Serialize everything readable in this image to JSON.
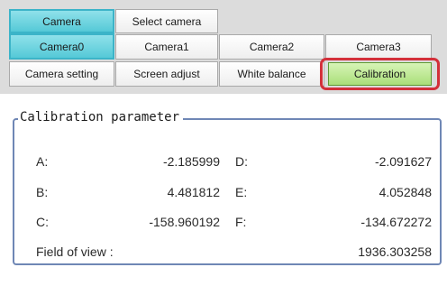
{
  "tabs": {
    "row1": [
      "Camera",
      "Select camera"
    ],
    "row2": [
      "Camera0",
      "Camera1",
      "Camera2",
      "Camera3"
    ],
    "row3": [
      "Camera setting",
      "Screen adjust",
      "White balance",
      "Calibration"
    ]
  },
  "calibration": {
    "title": "Calibration parameter",
    "rows": [
      {
        "l1": "A:",
        "v1": "-2.185999",
        "l2": "D:",
        "v2": "-2.091627"
      },
      {
        "l1": "B:",
        "v1": "4.481812",
        "l2": "E:",
        "v2": "4.052848"
      },
      {
        "l1": "C:",
        "v1": "-158.960192",
        "l2": "F:",
        "v2": "-134.672272"
      }
    ],
    "fov_label": "Field of view :",
    "fov_value": "1936.303258"
  },
  "colors": {
    "selected_tab": "#55c9d7",
    "highlight_outline": "#d3303a",
    "calibration_tab": "#aadf7a",
    "group_border": "#6f87b5"
  }
}
